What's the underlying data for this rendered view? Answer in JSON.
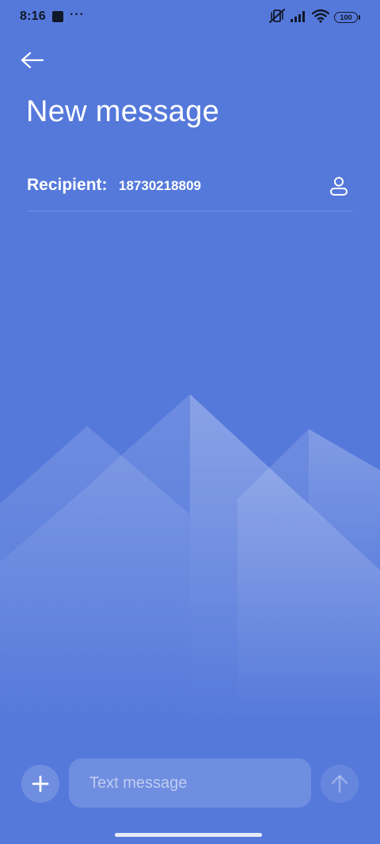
{
  "status_bar": {
    "time": "8:16",
    "more": "···",
    "battery": "100"
  },
  "header": {
    "title": "New message",
    "back_icon": "arrow-left-icon"
  },
  "recipient": {
    "label": "Recipient:",
    "value": "18730218809",
    "contact_icon": "person-icon"
  },
  "composer": {
    "placeholder": "Text message",
    "attach_icon": "plus-icon",
    "send_icon": "arrow-up-icon"
  },
  "colors": {
    "background": "#5579DB",
    "text": "#FFFFFF",
    "status_text": "#111827"
  }
}
